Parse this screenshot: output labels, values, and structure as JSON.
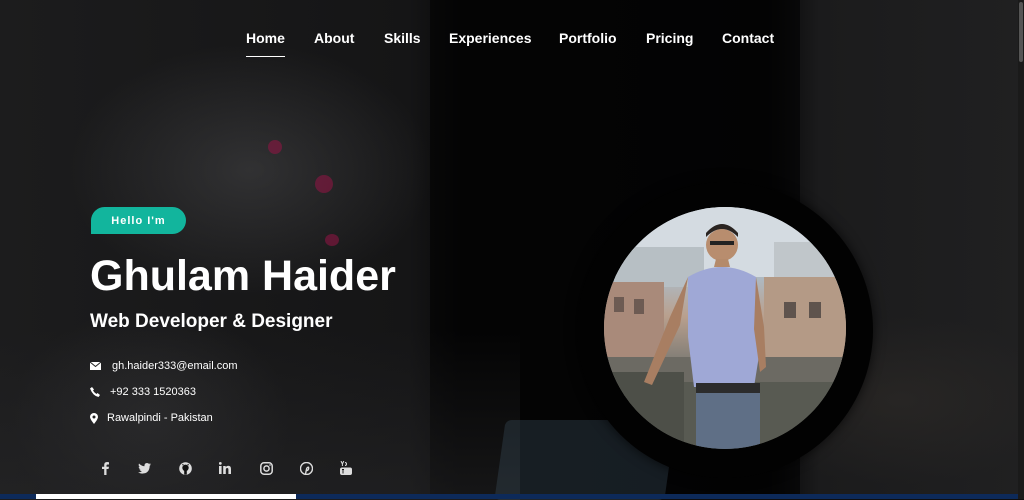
{
  "nav": {
    "items": [
      {
        "label": "Home",
        "active": true
      },
      {
        "label": "About"
      },
      {
        "label": "Skills"
      },
      {
        "label": "Experiences"
      },
      {
        "label": "Portfolio"
      },
      {
        "label": "Pricing"
      },
      {
        "label": "Contact"
      }
    ]
  },
  "hero": {
    "badge": "Hello I'm",
    "name": "Ghulam Haider",
    "role": "Web Developer & Designer",
    "contacts": [
      {
        "icon": "envelope-icon",
        "text": "gh.haider333@email.com"
      },
      {
        "icon": "phone-icon",
        "text": "+92 333 1520363"
      },
      {
        "icon": "map-pin-icon",
        "text": "Rawalpindi - Pakistan"
      }
    ]
  },
  "social": [
    {
      "icon": "facebook-icon",
      "glyph": "f"
    },
    {
      "icon": "twitter-icon",
      "glyph": ""
    },
    {
      "icon": "github-icon",
      "glyph": ""
    },
    {
      "icon": "linkedin-icon",
      "glyph": "in"
    },
    {
      "icon": "instagram-icon",
      "glyph": ""
    },
    {
      "icon": "pinterest-icon",
      "glyph": ""
    },
    {
      "icon": "youtube-icon",
      "glyph": ""
    }
  ],
  "colors": {
    "accent": "#12b59d",
    "background": "#0e0e0f",
    "text": "#ffffff"
  }
}
